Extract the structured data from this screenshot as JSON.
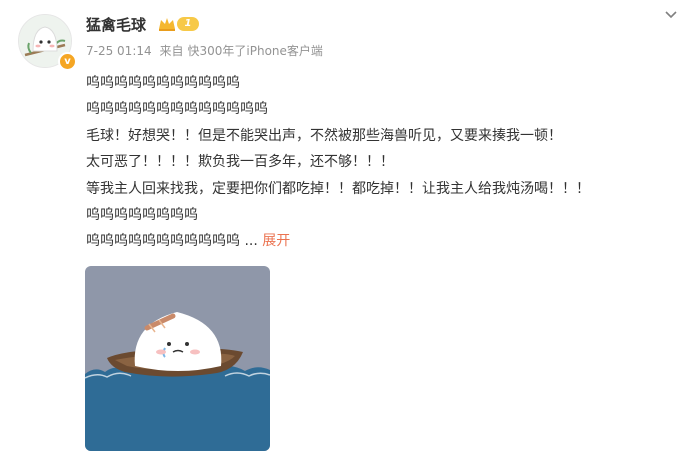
{
  "post": {
    "username": "猛禽毛球",
    "level_label": "1",
    "verified_badge": "v",
    "timestamp": "7-25 01:14",
    "source_prefix": "来自",
    "source": "快300年了iPhone客户端",
    "lines": [
      "呜呜呜呜呜呜呜呜呜呜呜",
      "呜呜呜呜呜呜呜呜呜呜呜呜呜",
      "毛球！好想哭！！但是不能哭出声，不然被那些海兽听见，又要来揍我一顿！",
      "太可恶了！！！！欺负我一百多年，还不够！！！",
      "等我主人回来找我，定要把你们都吃掉！！都吃掉！！让我主人给我炖汤喝！！！",
      "呜呜呜呜呜呜呜呜",
      "呜呜呜呜呜呜呜呜呜呜呜"
    ],
    "ellipsis": " ...",
    "expand_label": "展开"
  },
  "icons": {
    "more": "chevron-down-icon",
    "level": "crown-icon"
  },
  "colors": {
    "link": "#eb7350",
    "meta": "#939393",
    "text": "#333333",
    "badge": "#f5a623"
  }
}
